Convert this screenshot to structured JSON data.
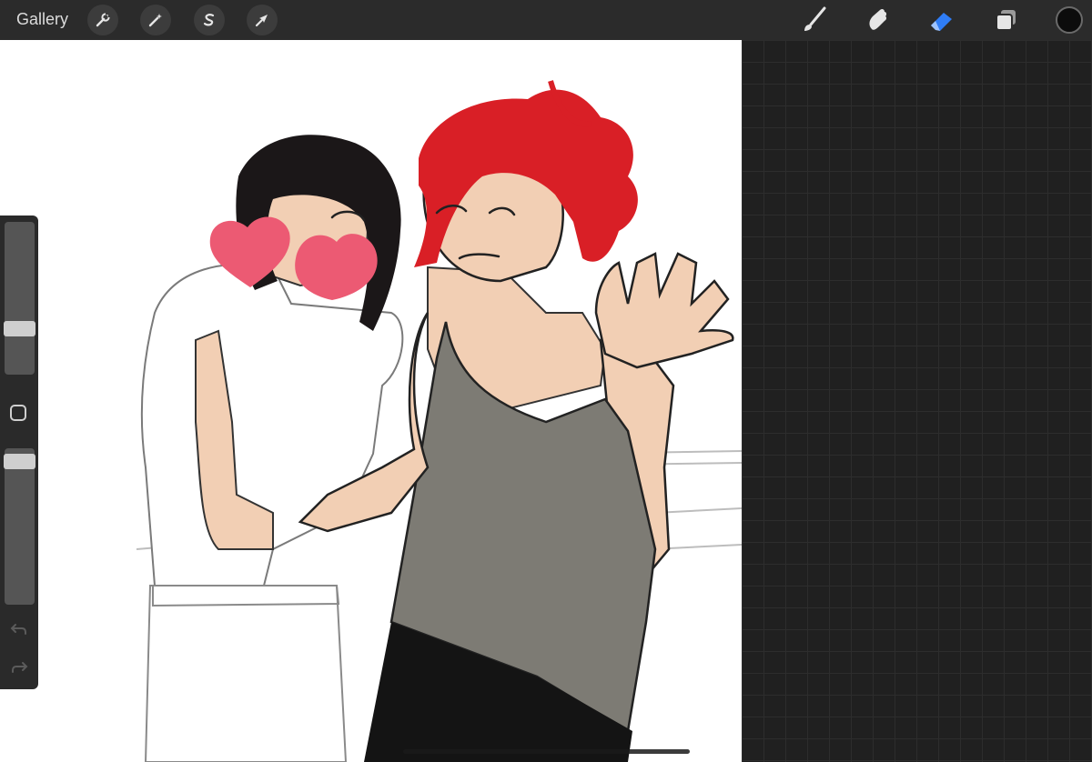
{
  "app": {
    "gallery_label": "Gallery"
  },
  "toolbar_left": [
    {
      "name": "actions",
      "icon": "wrench-icon"
    },
    {
      "name": "adjustments",
      "icon": "magic-wand-icon"
    },
    {
      "name": "selection",
      "icon": "selection-s-icon"
    },
    {
      "name": "transform",
      "icon": "arrow-cursor-icon"
    }
  ],
  "toolbar_right": [
    {
      "name": "brush",
      "icon": "brush-icon"
    },
    {
      "name": "smudge",
      "icon": "smudge-finger-icon"
    },
    {
      "name": "eraser",
      "icon": "eraser-icon",
      "active": true
    },
    {
      "name": "layers",
      "icon": "layers-icon"
    }
  ],
  "colors": {
    "accent_active": "#2f7df6",
    "current_color": "#0c0c0c",
    "toolbar_bg": "#2b2b2b",
    "canvas_bg": "#ffffff",
    "hair_red": "#d91f26",
    "heart_pink": "#ec5a73",
    "skin": "#f2cfb4",
    "top_gray": "#7d7b74"
  },
  "sidebar": {
    "brush_size_level": 0.28,
    "opacity_level": 0.96,
    "modifier_icon": "square-modifier-icon",
    "undo_icon": "undo-icon",
    "redo_icon": "redo-icon"
  }
}
